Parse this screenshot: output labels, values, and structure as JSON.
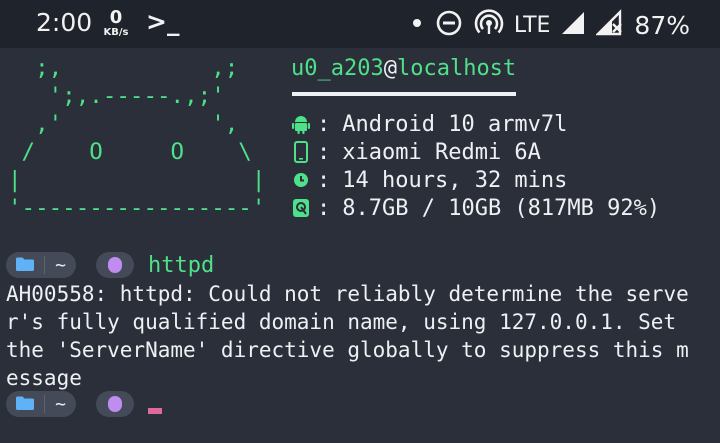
{
  "status_bar": {
    "time": "2:00",
    "net_speed_value": "0",
    "net_speed_unit": "KB/s",
    "terminal_icon": ">_",
    "icons": [
      "dot-icon",
      "do-not-disturb-icon",
      "hotspot-icon",
      "signal-icon",
      "signal-no-data-icon"
    ],
    "network_type": "LTE",
    "battery": "87%"
  },
  "neofetch": {
    "ascii_art": "  ;,           ,;\n   ';,.-----.,;'\n  ,'           ',\n /    O     O    \\\n|                 |\n'-----------------'",
    "user": "u0_a203",
    "at": "@",
    "host": "localhost",
    "info": [
      {
        "icon": "android-icon",
        "value": "Android 10 armv7l"
      },
      {
        "icon": "phone-icon",
        "value": "xiaomi Redmi 6A"
      },
      {
        "icon": "clock-icon",
        "value": "14 hours, 32 mins"
      },
      {
        "icon": "memory-icon",
        "value": "8.7GB / 10GB (817MB 92%)"
      }
    ],
    "colon": ":"
  },
  "prompt": {
    "tilde": "~",
    "command": "httpd"
  },
  "output": {
    "lines": [
      "AH00558: httpd: Could not reliably determine the serve",
      "r's fully qualified domain name, using 127.0.0.1. Set",
      "the 'ServerName' directive globally to suppress this m",
      "essage"
    ]
  },
  "colors": {
    "background": "#2b2f39",
    "status_bar": "#1f232b",
    "green": "#4fe08a",
    "pill": "#444a58",
    "folder_blue": "#5fb2f5",
    "purple": "#c18cf0",
    "cursor": "#e0699c"
  }
}
